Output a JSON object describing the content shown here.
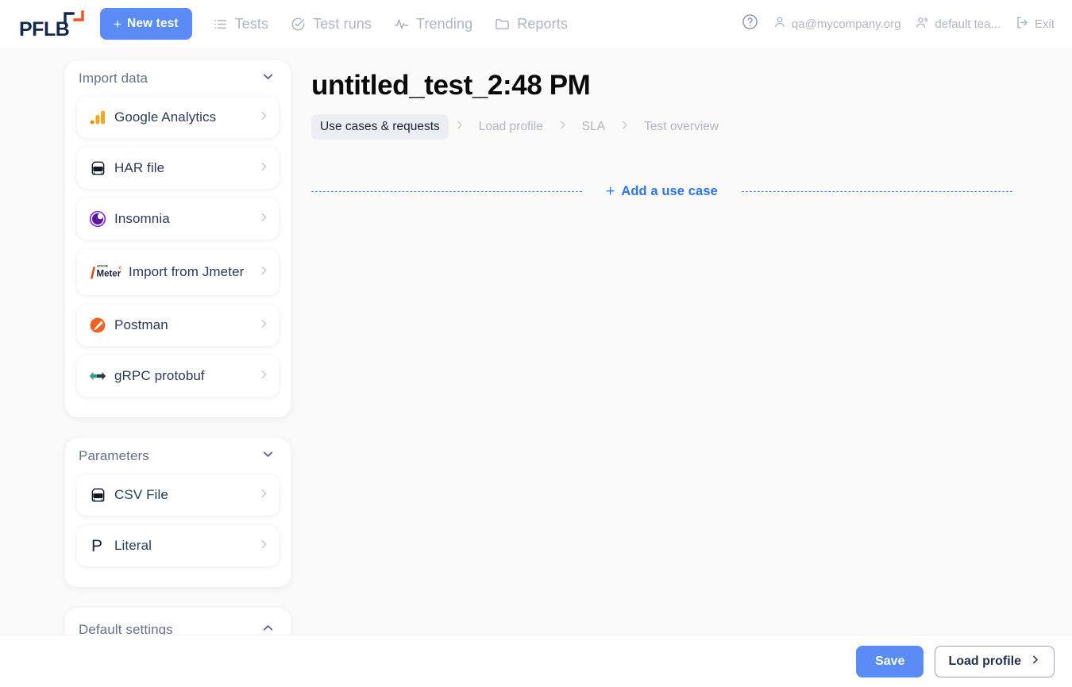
{
  "header": {
    "logo_text": "PFLB",
    "new_test_label": "New test",
    "new_test_plus": "+",
    "nav": [
      {
        "label": "Tests",
        "icon": "list-icon"
      },
      {
        "label": "Test runs",
        "icon": "check-circle-icon"
      },
      {
        "label": "Trending",
        "icon": "activity-icon"
      },
      {
        "label": "Reports",
        "icon": "folder-icon"
      }
    ],
    "right": {
      "help": "?",
      "user": "qa@mycompany.org",
      "team": "default tea...",
      "exit": "Exit"
    }
  },
  "sidebar": {
    "sections": [
      {
        "title": "Import data",
        "expanded": true,
        "chevron": "chevron-down",
        "items": [
          {
            "label": "Google Analytics",
            "icon": "google-analytics-icon"
          },
          {
            "label": "HAR file",
            "icon": "har-file-icon"
          },
          {
            "label": "Insomnia",
            "icon": "insomnia-icon"
          },
          {
            "label": "Import from Jmeter",
            "icon": "jmeter-icon"
          },
          {
            "label": "Postman",
            "icon": "postman-icon"
          },
          {
            "label": "gRPC protobuf",
            "icon": "grpc-icon"
          }
        ]
      },
      {
        "title": "Parameters",
        "expanded": true,
        "chevron": "chevron-down",
        "items": [
          {
            "label": "CSV File",
            "icon": "csv-file-icon"
          },
          {
            "label": "Literal",
            "icon": "literal-p-icon"
          }
        ]
      },
      {
        "title": "Default settings",
        "expanded": false,
        "chevron": "chevron-up",
        "items": []
      }
    ]
  },
  "main": {
    "title": "untitled_test_2:48 PM",
    "breadcrumb": [
      {
        "label": "Use cases & requests",
        "active": true
      },
      {
        "label": "Load profile",
        "active": false
      },
      {
        "label": "SLA",
        "active": false
      },
      {
        "label": "Test overview",
        "active": false
      }
    ],
    "add_use_case": {
      "plus": "+",
      "label": "Add a use case"
    }
  },
  "footer": {
    "save_label": "Save",
    "load_profile_label": "Load profile"
  },
  "colors": {
    "accent_blue": "#5b8cf5",
    "link_blue": "#2e74ef",
    "logo_navy": "#12284c",
    "logo_orange": "#f4501e",
    "muted": "#aeb6c4",
    "page_bg": "#fafafb"
  }
}
